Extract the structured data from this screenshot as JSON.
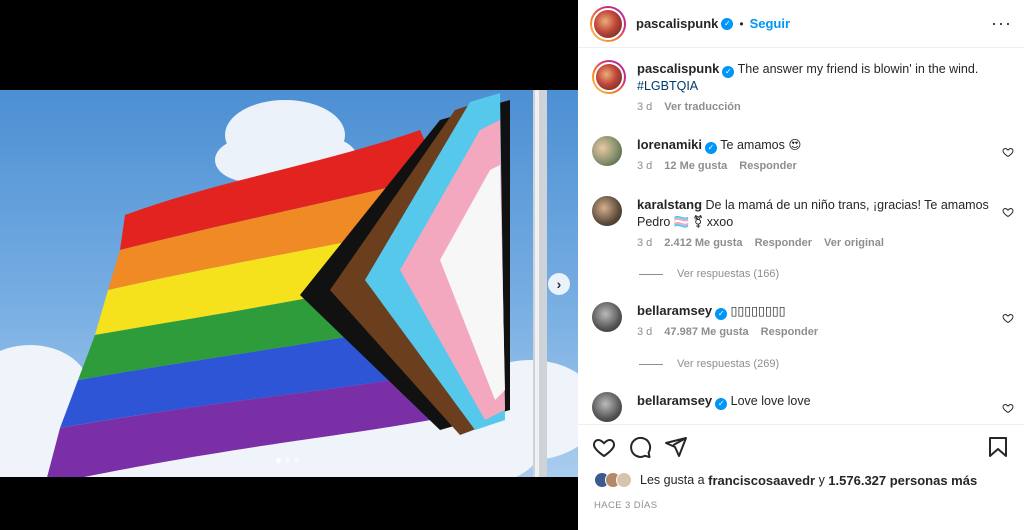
{
  "post": {
    "username": "pascalispunk",
    "follow_label": "Seguir",
    "separator": "•"
  },
  "caption": {
    "username": "pascalispunk",
    "text": "The answer my friend is blowin' in the wind.",
    "hashtag": "#LGBTQIA",
    "age": "3 d",
    "translate": "Ver traducción"
  },
  "comments": [
    {
      "username": "lorenamiki",
      "text": "Te amamos 😍",
      "age": "3 d",
      "likes": "12 Me gusta",
      "reply": "Responder",
      "original": "",
      "view_replies": ""
    },
    {
      "username": "karalstang",
      "text": "De la mamá de un niño trans, ¡gracias! Te amamos Pedro 🏳️‍⚧️ ⚧ xxoo",
      "age": "3 d",
      "likes": "2.412 Me gusta",
      "reply": "Responder",
      "original": "Ver original",
      "view_replies": "Ver respuestas (166)"
    },
    {
      "username": "bellaramsey",
      "text": "▯▯▯▯▯▯▯▯",
      "age": "3 d",
      "likes": "47.987 Me gusta",
      "reply": "Responder",
      "original": "",
      "view_replies": "Ver respuestas (269)"
    },
    {
      "username": "bellaramsey",
      "text": "Love love love",
      "age": "",
      "likes": "",
      "reply": "",
      "original": "",
      "view_replies": ""
    }
  ],
  "likes_line": {
    "prefix": "Les gusta a",
    "user": "franciscosaavedr",
    "conj": "y",
    "count": "1.576.327 personas más"
  },
  "timestamp": "HACE 3 DÍAS",
  "carousel": {
    "total": 3,
    "active": 1
  },
  "icons": [
    "verified-icon",
    "more-icon",
    "heart-icon",
    "comment-icon",
    "share-icon",
    "save-icon",
    "chevron-right-icon"
  ],
  "colors": {
    "accent": "#0095f6",
    "hashtag": "#00376b",
    "muted": "#8e8e8e"
  }
}
